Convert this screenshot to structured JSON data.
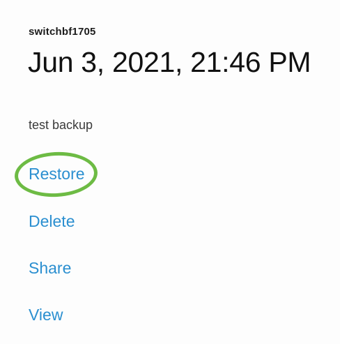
{
  "backup": {
    "device": "switchbf1705",
    "date": "Jun 3, 2021, 21:46 PM",
    "note": "test backup"
  },
  "actions": {
    "restore": "Restore",
    "delete": "Delete",
    "share": "Share",
    "view": "View"
  },
  "colors": {
    "link": "#2b8fd0",
    "highlight": "#6dbb44",
    "text": "#111111"
  }
}
